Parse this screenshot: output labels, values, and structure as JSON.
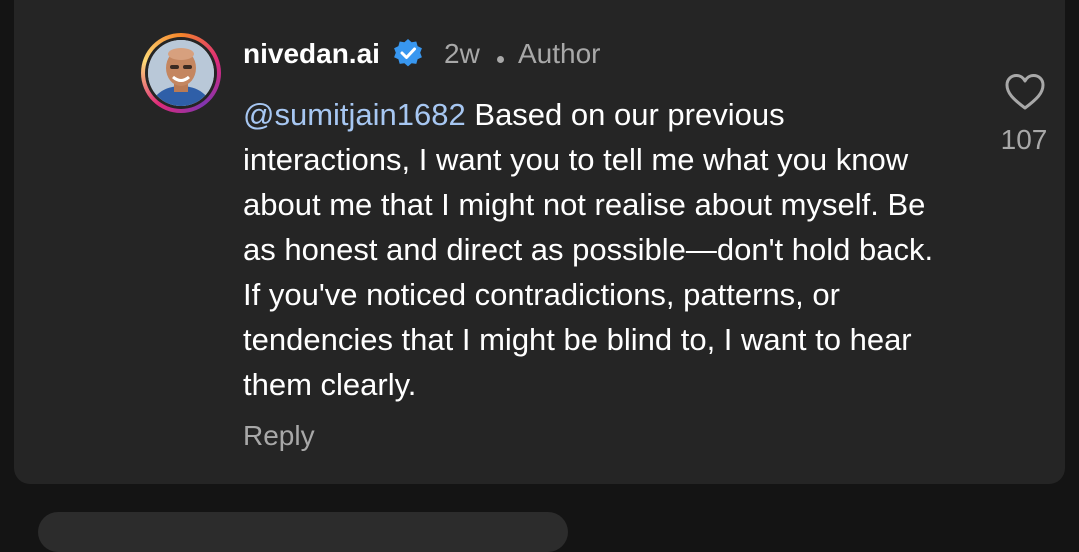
{
  "comment": {
    "username": "nivedan.ai",
    "time": "2w",
    "role": "Author",
    "mention": "@sumitjain1682",
    "text": "Based on our previous interactions, I want you to tell me what you know about me that I might not realise about myself. Be as honest and direct as possible—don't hold back. If you've noticed contradictions, patterns, or tendencies that I might be blind to, I want to hear them clearly.",
    "reply_label": "Reply",
    "like_count": "107"
  },
  "colors": {
    "background": "#252525",
    "text": "#ffffff",
    "muted": "#a8a8a8",
    "mention": "#a7c7f2",
    "verified": "#3897f0"
  },
  "icons": {
    "verified": "verified-badge-icon",
    "like": "heart-outline-icon"
  }
}
